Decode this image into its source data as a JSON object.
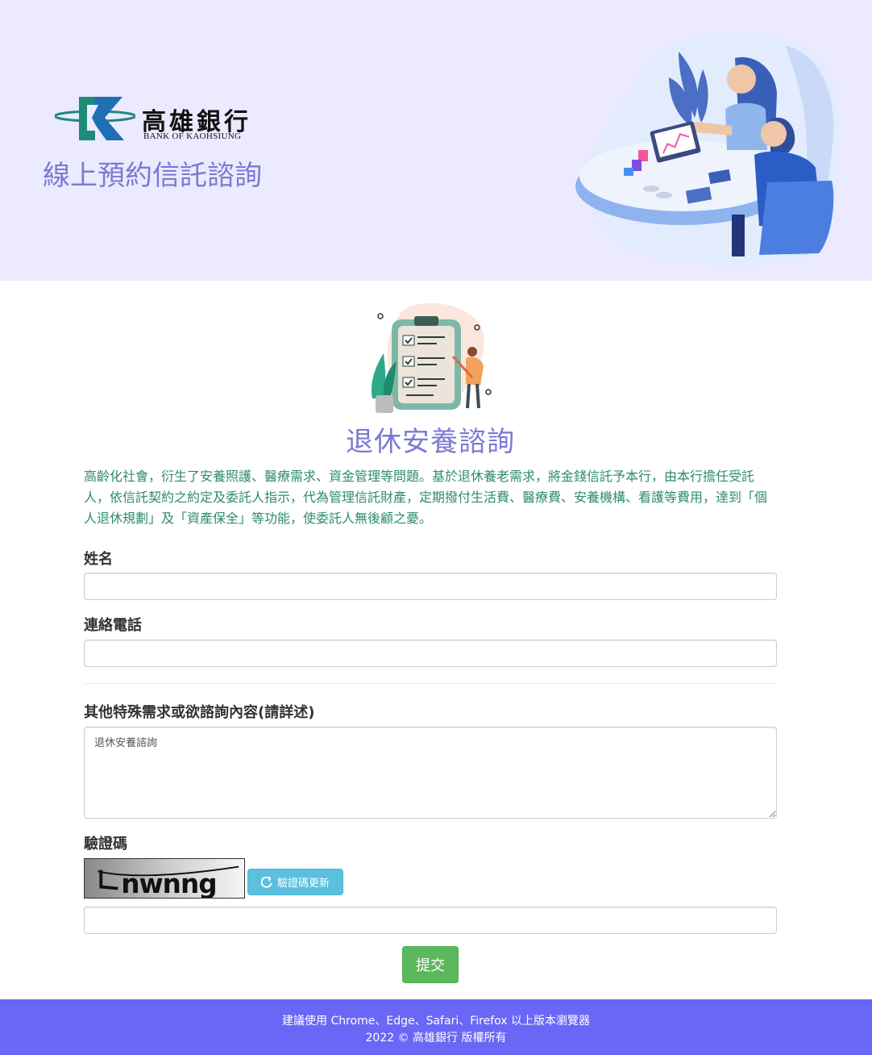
{
  "header": {
    "logo_zh": "高雄銀行",
    "logo_en": "BANK OF KAOHSIUNG",
    "site_title": "線上預約信託諮詢"
  },
  "main": {
    "page_title": "退休安養諮詢",
    "intro": "高齡化社會，衍生了安養照護、醫療需求、資金管理等問題。基於退休養老需求，將金錢信託予本行，由本行擔任受託人，依信託契約之約定及委託人指示，代為管理信託財產，定期撥付生活費、醫療費、安養機構、看護等費用，達到「個人退休規劃」及「資產保全」等功能，使委託人無後顧之憂。"
  },
  "form": {
    "name_label": "姓名",
    "name_value": "",
    "phone_label": "連絡電話",
    "phone_value": "",
    "notes_label": "其他特殊需求或欲諮詢內容(請詳述)",
    "notes_value": "退休安養諮詢",
    "captcha_label": "驗證碼",
    "captcha_text": "nwnng",
    "captcha_refresh_label": "驗證碼更新",
    "captcha_value": "",
    "submit_label": "提交"
  },
  "footer": {
    "browser_note": "建議使用 Chrome、Edge、Safari、Firefox 以上版本瀏覽器",
    "copyright": "2022 © 高雄銀行 版權所有"
  },
  "colors": {
    "banner_bg": "#ebeafe",
    "title_purple": "#7b79d3",
    "intro_green": "#2e8b6e",
    "refresh_button": "#5bc0de",
    "submit_button": "#5cb85c",
    "footer_bg": "#6a67f6"
  },
  "icons": [
    "bank-logo-icon",
    "consulting-illustration",
    "checklist-illustration",
    "refresh-icon"
  ]
}
